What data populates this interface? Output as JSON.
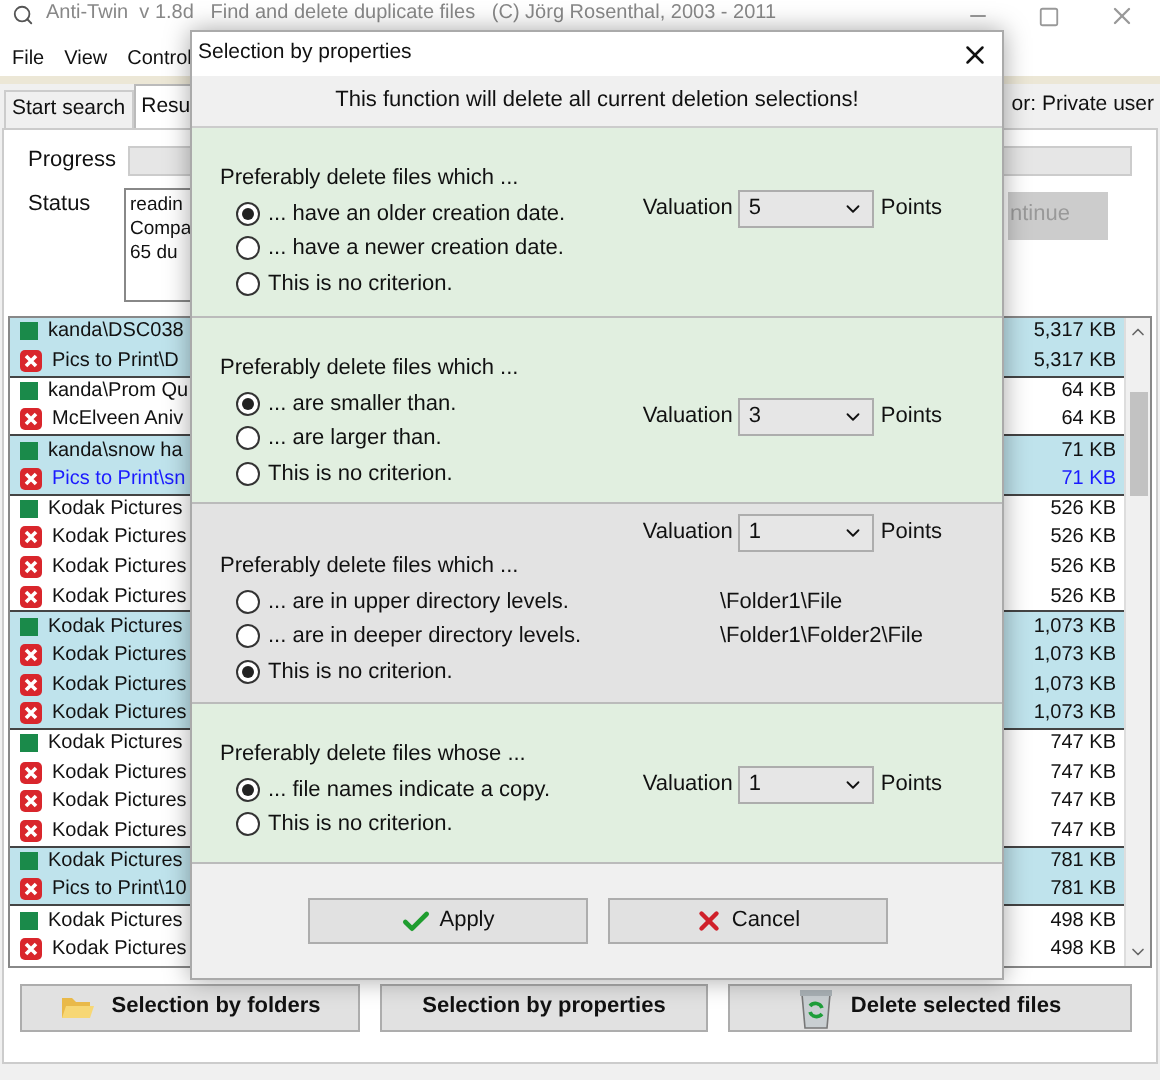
{
  "window": {
    "title": "Anti-Twin  v 1.8d   Find and delete duplicate files   (C) Jörg Rosenthal, 2003 - 2011"
  },
  "menu": [
    "File",
    "View",
    "Control"
  ],
  "tabs": [
    {
      "label": "Start search",
      "selected": false
    },
    {
      "label": "Resu",
      "selected": true
    }
  ],
  "license": "or: Private user",
  "progress": {
    "label": "Progress",
    "level": 0
  },
  "status": {
    "label": "Status",
    "lines": [
      "readin",
      "Compa",
      "65 du"
    ]
  },
  "continue_button": {
    "label": "ntinue",
    "disabled": true
  },
  "files": [
    {
      "kind": "keep",
      "name": "kanda\\DSC038",
      "size": "5,317 KB",
      "highlighted": true,
      "selected": false
    },
    {
      "kind": "delete",
      "name": "Pics to Print\\D",
      "size": "5,317 KB",
      "highlighted": true,
      "selected": false
    },
    {
      "kind": "keep",
      "name": "kanda\\Prom Qu",
      "size": "64 KB",
      "highlighted": false,
      "selected": false
    },
    {
      "kind": "delete",
      "name": "McElveen Aniv",
      "size": "64 KB",
      "highlighted": false,
      "selected": false
    },
    {
      "kind": "keep",
      "name": "kanda\\snow ha",
      "size": "71 KB",
      "highlighted": true,
      "selected": false
    },
    {
      "kind": "delete",
      "name": "Pics to Print\\sn",
      "size": "71 KB",
      "highlighted": true,
      "selected": true
    },
    {
      "kind": "keep",
      "name": "Kodak Pictures",
      "size": "526 KB",
      "highlighted": false,
      "selected": false
    },
    {
      "kind": "delete",
      "name": "Kodak Pictures",
      "size": "526 KB",
      "highlighted": false,
      "selected": false
    },
    {
      "kind": "delete",
      "name": "Kodak Pictures",
      "size": "526 KB",
      "highlighted": false,
      "selected": false
    },
    {
      "kind": "delete",
      "name": "Kodak Pictures",
      "size": "526 KB",
      "highlighted": false,
      "selected": false
    },
    {
      "kind": "keep",
      "name": "Kodak Pictures",
      "size": "1,073 KB",
      "highlighted": true,
      "selected": false
    },
    {
      "kind": "delete",
      "name": "Kodak Pictures",
      "size": "1,073 KB",
      "highlighted": true,
      "selected": false
    },
    {
      "kind": "delete",
      "name": "Kodak Pictures",
      "size": "1,073 KB",
      "highlighted": true,
      "selected": false
    },
    {
      "kind": "delete",
      "name": "Kodak Pictures",
      "size": "1,073 KB",
      "highlighted": true,
      "selected": false
    },
    {
      "kind": "keep",
      "name": "Kodak Pictures",
      "size": "747 KB",
      "highlighted": false,
      "selected": false
    },
    {
      "kind": "delete",
      "name": "Kodak Pictures",
      "size": "747 KB",
      "highlighted": false,
      "selected": false
    },
    {
      "kind": "delete",
      "name": "Kodak Pictures",
      "size": "747 KB",
      "highlighted": false,
      "selected": false
    },
    {
      "kind": "delete",
      "name": "Kodak Pictures",
      "size": "747 KB",
      "highlighted": false,
      "selected": false
    },
    {
      "kind": "keep",
      "name": "Kodak Pictures",
      "size": "781 KB",
      "highlighted": true,
      "selected": false
    },
    {
      "kind": "delete",
      "name": "Pics to Print\\10",
      "size": "781 KB",
      "highlighted": true,
      "selected": false
    },
    {
      "kind": "keep",
      "name": "Kodak Pictures",
      "size": "498 KB",
      "highlighted": false,
      "selected": false
    },
    {
      "kind": "delete",
      "name": "Kodak Pictures",
      "size": "498 KB",
      "highlighted": false,
      "selected": false
    }
  ],
  "buttons": [
    {
      "kind": "folder",
      "label": "Selection by folders"
    },
    {
      "kind": "plain",
      "label": "Selection by properties"
    },
    {
      "kind": "trash",
      "label": "Delete selected files"
    }
  ],
  "dialog": {
    "title": "Selection by properties",
    "notice": "This function will delete all current deletion selections!",
    "sections": [
      {
        "kind": "plain",
        "color": "#e1efe0",
        "heading": "Preferably delete files which ...",
        "valuation": {
          "label": "Valuation",
          "value": "5",
          "unit": "Points"
        },
        "options": [
          {
            "label": "... have an older creation date.",
            "selected": true
          },
          {
            "label": "... have a newer creation date.",
            "selected": false
          },
          {
            "label": "This is no criterion.",
            "selected": false
          }
        ]
      },
      {
        "kind": "plain",
        "color": "#e1efe0",
        "heading": "Preferably delete files which ...",
        "valuation": {
          "label": "Valuation",
          "value": "3",
          "unit": "Points"
        },
        "options": [
          {
            "label": "... are smaller than.",
            "selected": true
          },
          {
            "label": "... are larger than.",
            "selected": false
          },
          {
            "label": "This is no criterion.",
            "selected": false
          }
        ]
      },
      {
        "kind": "paths",
        "color": "#e3e3e3",
        "heading": "Preferably delete files which ...",
        "valuation": {
          "label": "Valuation",
          "value": "1",
          "unit": "Points"
        },
        "options": [
          {
            "label": "... are in upper directory levels.",
            "path": "\\Folder1\\File",
            "selected": false
          },
          {
            "label": "... are in deeper directory levels.",
            "path": "\\Folder1\\Folder2\\File",
            "selected": false
          },
          {
            "label": "This is no criterion.",
            "selected": true
          }
        ]
      },
      {
        "kind": "plain",
        "color": "#e1efe0",
        "heading": "Preferably delete files whose ...",
        "valuation": {
          "label": "Valuation",
          "value": "1",
          "unit": "Points"
        },
        "options": [
          {
            "label": "... file names indicate a copy.",
            "selected": true
          },
          {
            "label": "This is no criterion.",
            "selected": false
          }
        ]
      }
    ],
    "actions": [
      {
        "kind": "apply",
        "label": "Apply"
      },
      {
        "kind": "cancel",
        "label": "Cancel"
      }
    ]
  }
}
